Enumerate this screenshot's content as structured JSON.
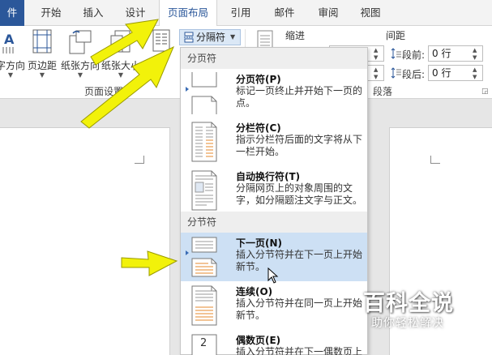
{
  "tabs": [
    {
      "label": "件"
    },
    {
      "label": "开始"
    },
    {
      "label": "插入"
    },
    {
      "label": "设计"
    },
    {
      "label": "页面布局"
    },
    {
      "label": "引用"
    },
    {
      "label": "邮件"
    },
    {
      "label": "审阅"
    },
    {
      "label": "视图"
    }
  ],
  "ribbon": {
    "buttons": [
      {
        "label": "字方向"
      },
      {
        "label": "页边距"
      },
      {
        "label": "纸张方向"
      },
      {
        "label": "纸张大小"
      }
    ],
    "breaks_label": "分隔符",
    "page_setup_label": "页面设置",
    "indent_label": "缩进",
    "spacing_label": "间距",
    "before_label": "段前:",
    "before_value": "0 行",
    "after_label": "段后:",
    "after_value": "0 行",
    "paragraph_label": "段落"
  },
  "menu": {
    "page_breaks_header": "分页符",
    "section_breaks_header": "分节符",
    "items": [
      {
        "title": "分页符(P)",
        "desc": "标记一页终止并开始下一页的点。"
      },
      {
        "title": "分栏符(C)",
        "desc": "指示分栏符后面的文字将从下一栏开始。"
      },
      {
        "title": "自动换行符(T)",
        "desc": "分隔网页上的对象周围的文字，如分隔题注文字与正文。"
      },
      {
        "title": "下一页(N)",
        "desc": "插入分节符并在下一页上开始新节。"
      },
      {
        "title": "连续(O)",
        "desc": "插入分节符并在同一页上开始新节。"
      },
      {
        "title": "偶数页(E)",
        "desc": "插入分节符并在下一偶数页上"
      }
    ],
    "even_thumb_number": "2"
  },
  "watermark": {
    "title": "百科全说",
    "subtitle": "助你轻松解决"
  },
  "colors": {
    "accent": "#2b579a",
    "highlight": "#cde0f4",
    "arrow": "#f2f20a"
  }
}
